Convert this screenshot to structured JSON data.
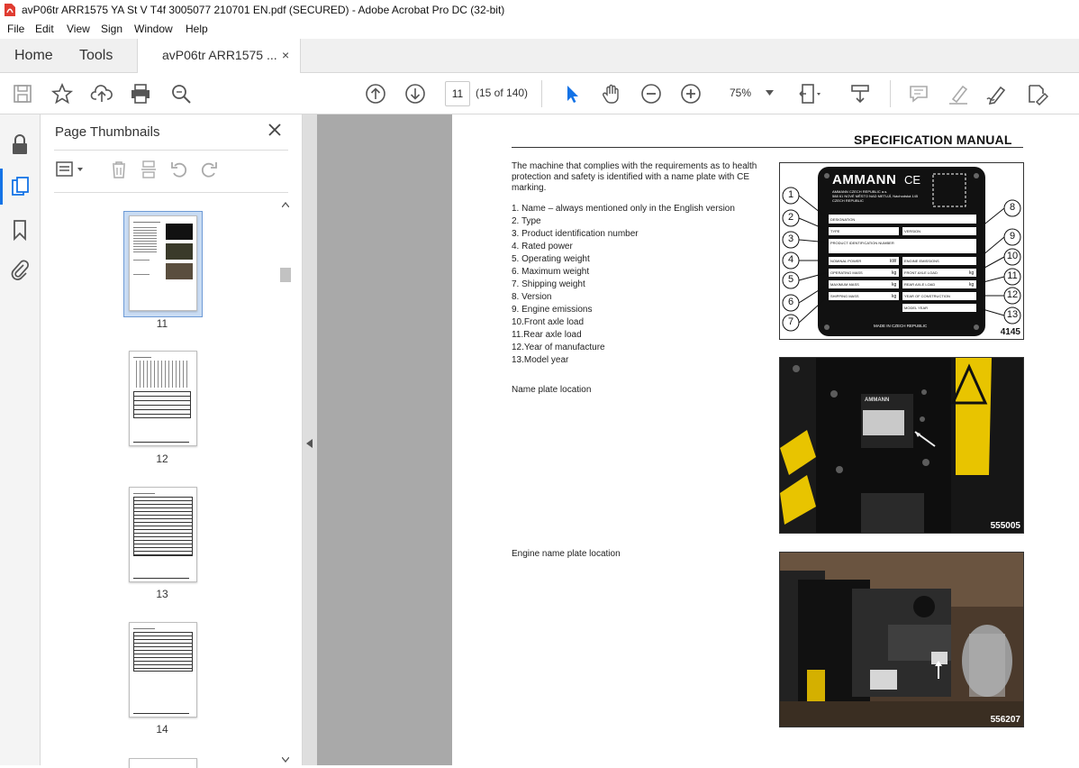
{
  "window": {
    "title": "avP06tr ARR1575 YA St V T4f 3005077 210701 EN.pdf (SECURED) - Adobe Acrobat Pro DC (32-bit)"
  },
  "menu": [
    "File",
    "Edit",
    "View",
    "Sign",
    "Window",
    "Help"
  ],
  "tabs": {
    "home": "Home",
    "tools": "Tools",
    "document": "avP06tr ARR1575 ...",
    "close": "×"
  },
  "toolbar": {
    "page_number": "11",
    "page_count": "(15 of 140)",
    "zoom": "75%",
    "icons": [
      "save-icon",
      "star-icon",
      "upload-icon",
      "print-icon",
      "search-icon",
      "page-up-icon",
      "page-down-icon",
      "select-cursor-icon",
      "hand-icon",
      "zoom-out-icon",
      "zoom-in-icon",
      "page-fit-icon",
      "scroll-mode-icon",
      "comment-icon",
      "highlight-icon",
      "sign-icon",
      "fill-sign-icon"
    ]
  },
  "sidebar": {
    "title": "Page Thumbnails",
    "thumbnails": [
      {
        "label": "11",
        "selected": true
      },
      {
        "label": "12",
        "selected": false
      },
      {
        "label": "13",
        "selected": false
      },
      {
        "label": "14",
        "selected": false
      }
    ]
  },
  "page": {
    "header": "SPECIFICATION MANUAL",
    "intro": "The machine that complies with the requirements as to health protection and safety is identified with a name plate with CE marking.",
    "items": [
      "1. Name – always mentioned only in the English version",
      "2. Type",
      "3. Product identification number",
      "4. Rated power",
      "5. Operating weight",
      "6. Maximum weight",
      "7. Shipping weight",
      "8. Version",
      "9. Engine emissions",
      "10.Front axle load",
      "11.Rear axle load",
      "12.Year of manufacture",
      "13.Model year"
    ],
    "name_plate_location": "Name plate location",
    "engine_plate_location": "Engine name plate location",
    "figure1_id": "4145",
    "figure2_id": "555005",
    "figure3_id": "556207",
    "plate": {
      "brand": "AMMANN",
      "ce": "CE",
      "company": [
        "AMMANN CZECH REPUBLIC a.s.",
        "588 61 NOVÉ MĚSTO NAD METUJÍ, Náchodská 145",
        "CZECH REPUBLIC"
      ],
      "fields_left": [
        "DESIGNATION",
        "TYPE",
        "PRODUCT IDENTIFICATION NUMBER",
        "NOMINAL POWER",
        "OPERATING MASS",
        "MAXIMUM MASS",
        "SHIPPING MASS"
      ],
      "fields_right": [
        "VERSION",
        "ENGINE EMISSIONS",
        "FRONT AXLE LOAD",
        "REAR AXLE LOAD",
        "YEAR OF CONSTRUCTION",
        "MODEL YEAR"
      ],
      "units_left": [
        "kW",
        "kg",
        "kg",
        "kg"
      ],
      "units_right": [
        "kg",
        "kg"
      ],
      "footer": "MADE IN CZECH REPUBLIC",
      "callouts_left": [
        "1",
        "2",
        "3",
        "4",
        "5",
        "6",
        "7"
      ],
      "callouts_right": [
        "8",
        "9",
        "10",
        "11",
        "12",
        "13"
      ]
    }
  }
}
